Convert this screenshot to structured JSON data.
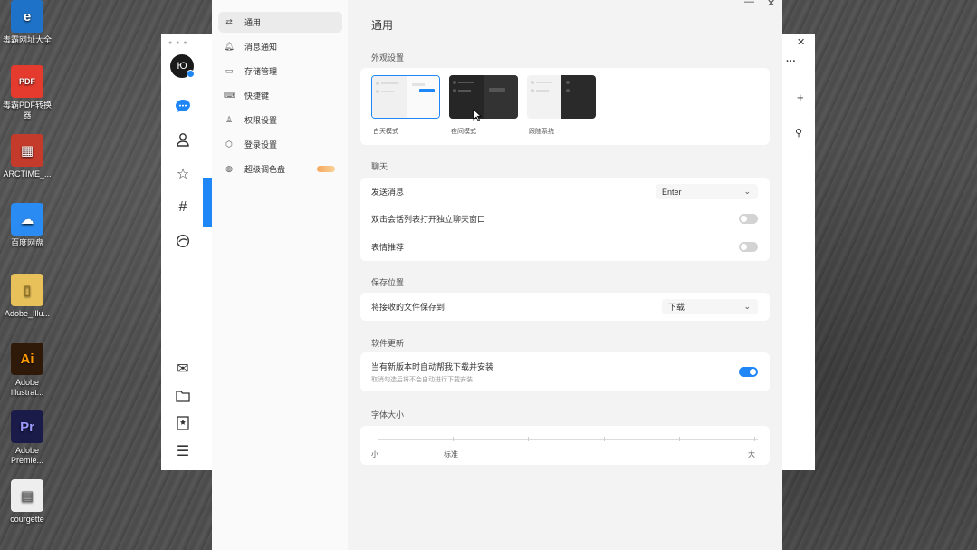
{
  "desktop": {
    "icons": [
      {
        "label": "毒霸网址大全",
        "icon": "edge-icon",
        "color": "#1e73c8"
      },
      {
        "label": "毒霸PDF转换器",
        "icon": "pdf-icon",
        "color": "#e53b2f"
      },
      {
        "label": "ARCTIME_...",
        "icon": "arctime-icon",
        "color": "#c43a2b"
      },
      {
        "label": "百度网盘",
        "icon": "baidu-netdisk-icon",
        "color": "#2a8bf2"
      },
      {
        "label": "Adobe_Illu...",
        "icon": "folder-icon",
        "color": "#e8c15a"
      },
      {
        "label": "Adobe Illustrat...",
        "icon": "illustrator-icon",
        "color": "#2f1a0a"
      },
      {
        "label": "Adobe Premie...",
        "icon": "premiere-icon",
        "color": "#1b1b4a"
      },
      {
        "label": "courgette",
        "icon": "document-icon",
        "color": "#eeeeee"
      }
    ]
  },
  "app": {
    "sidebar": [
      {
        "label": "通用",
        "icon": "sliders-icon",
        "active": true
      },
      {
        "label": "消息通知",
        "icon": "bell-icon"
      },
      {
        "label": "存储管理",
        "icon": "storage-icon"
      },
      {
        "label": "快捷键",
        "icon": "keyboard-icon"
      },
      {
        "label": "权限设置",
        "icon": "user-lock-icon"
      },
      {
        "label": "登录设置",
        "icon": "shield-icon"
      },
      {
        "label": "超级调色盘",
        "icon": "palette-icon",
        "badge_color": "#f5a65b"
      }
    ],
    "title": "通用",
    "appearance": {
      "heading": "外观设置",
      "themes": [
        {
          "label": "白天模式",
          "selected": true
        },
        {
          "label": "夜间模式",
          "selected": false
        },
        {
          "label": "跟随系统",
          "selected": false
        }
      ]
    },
    "chat": {
      "heading": "聊天",
      "send_label": "发送消息",
      "send_value": "Enter",
      "double_click_label": "双击会话列表打开独立聊天窗口",
      "double_click_on": false,
      "emoji_label": "表情推荐",
      "emoji_on": false
    },
    "save": {
      "heading": "保存位置",
      "label": "将接收的文件保存到",
      "value": "下载"
    },
    "update": {
      "heading": "软件更新",
      "label": "当有新版本时自动帮我下载并安装",
      "sublabel": "取消勾选后将不会自动进行下载安装",
      "on": true
    },
    "font": {
      "heading": "字体大小",
      "min_label": "小",
      "mid_label": "标准",
      "max_label": "大",
      "level_fraction": 0.2
    },
    "accent": "#1f86f5"
  }
}
